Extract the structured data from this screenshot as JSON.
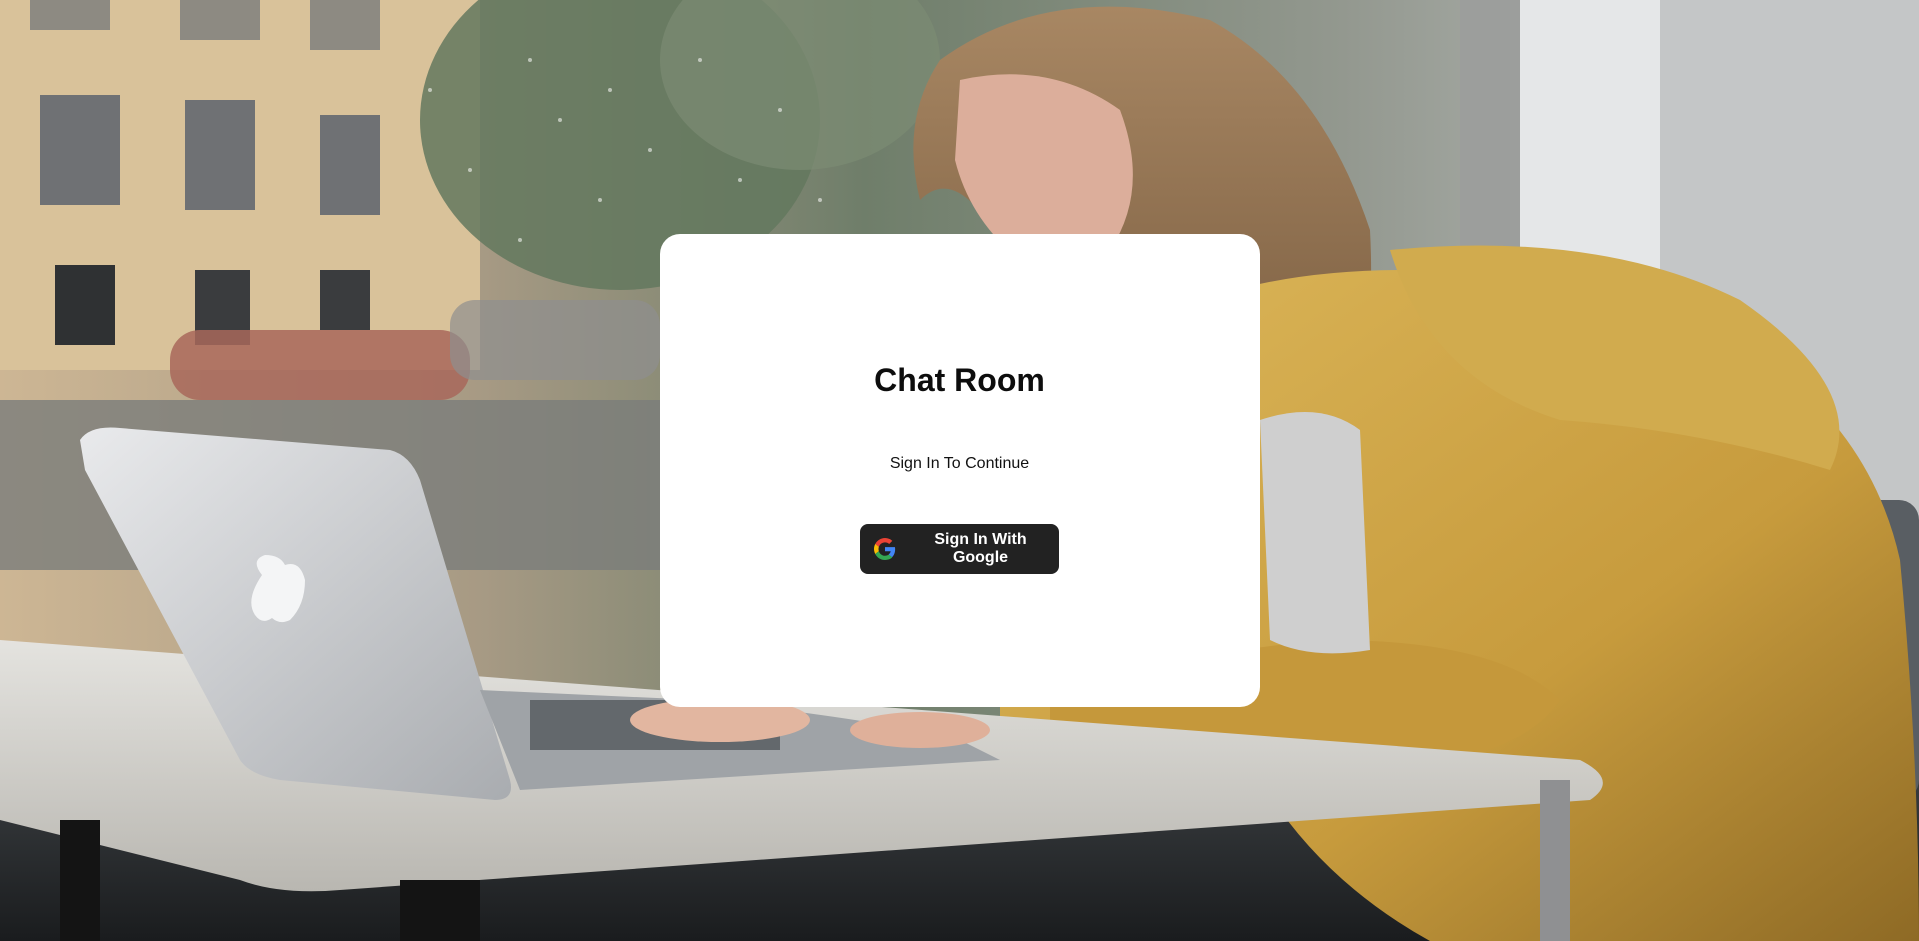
{
  "card": {
    "title": "Chat Room",
    "subtitle": "Sign In To Continue",
    "google_button_label": "Sign In With Google",
    "google_button_icon": "google-icon"
  },
  "colors": {
    "card_background": "#ffffff",
    "button_background": "#222222",
    "button_text": "#ffffff",
    "title_text": "#0d0d0d"
  },
  "background": {
    "image_subject": "woman in yellow hoodie typing on silver laptop at a table by a rainy window"
  }
}
